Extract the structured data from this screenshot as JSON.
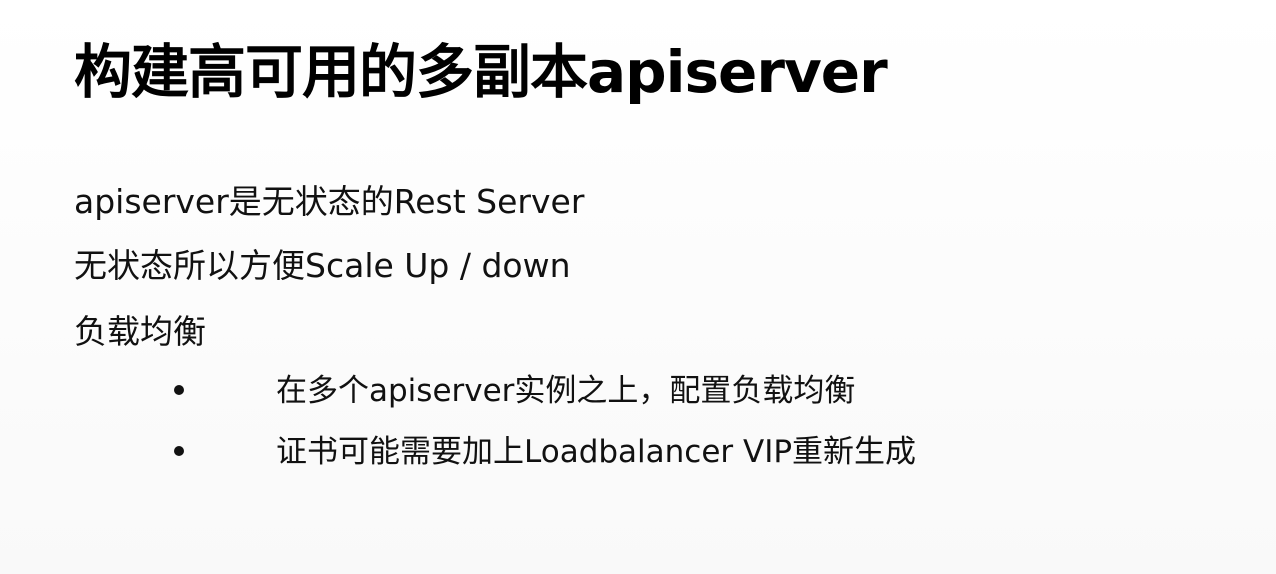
{
  "slide": {
    "title": "构建高可用的多副本apiserver",
    "lines": [
      "apiserver是无状态的Rest Server",
      "无状态所以方便Scale Up / down",
      "负载均衡"
    ],
    "bullets": [
      "在多个apiserver实例之上，配置负载均衡",
      "证书可能需要加上Loadbalancer VIP重新生成"
    ]
  }
}
